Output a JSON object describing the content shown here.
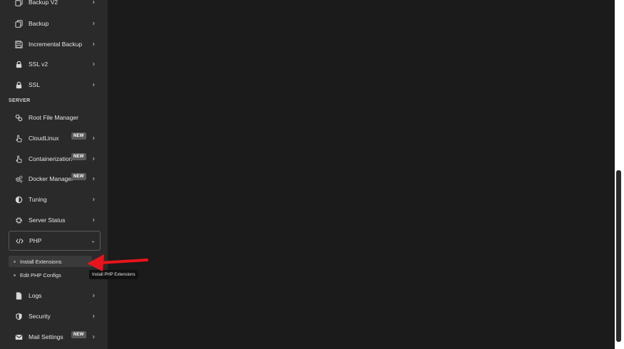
{
  "sidebar": {
    "section_label": "SERVER",
    "items": [
      {
        "label": "Backup V2",
        "icon": "copy-icon"
      },
      {
        "label": "Backup",
        "icon": "copy-icon"
      },
      {
        "label": "Incremental Backup",
        "icon": "save-icon"
      },
      {
        "label": "SSL v2",
        "icon": "lock-icon"
      },
      {
        "label": "SSL",
        "icon": "lock-icon"
      },
      {
        "label": "Root File Manager",
        "icon": "link-icon"
      },
      {
        "label": "CloudLinux",
        "icon": "hand-pointer-icon",
        "badge": "NEW"
      },
      {
        "label": "Containerization",
        "icon": "hand-pointer-icon",
        "badge": "NEW"
      },
      {
        "label": "Docker Manager",
        "icon": "cogs-icon",
        "badge": "NEW"
      },
      {
        "label": "Tuning",
        "icon": "adjust-icon"
      },
      {
        "label": "Server Status",
        "icon": "gear-icon"
      },
      {
        "label": "PHP",
        "icon": "code-icon"
      },
      {
        "label": "Logs",
        "icon": "file-icon"
      },
      {
        "label": "Security",
        "icon": "shield-icon"
      },
      {
        "label": "Mail Settings",
        "icon": "envelope-icon",
        "badge": "NEW"
      }
    ],
    "php_submenu": [
      {
        "label": "Install Extensions"
      },
      {
        "label": "Edit PHP Configs"
      }
    ]
  },
  "tooltip": "Install PHP Extensions",
  "colors": {
    "sidebar_bg": "#2a2a2a",
    "content_bg": "#1b1b1b",
    "badge_bg": "#5a5a5a",
    "arrow": "#e8141b"
  }
}
